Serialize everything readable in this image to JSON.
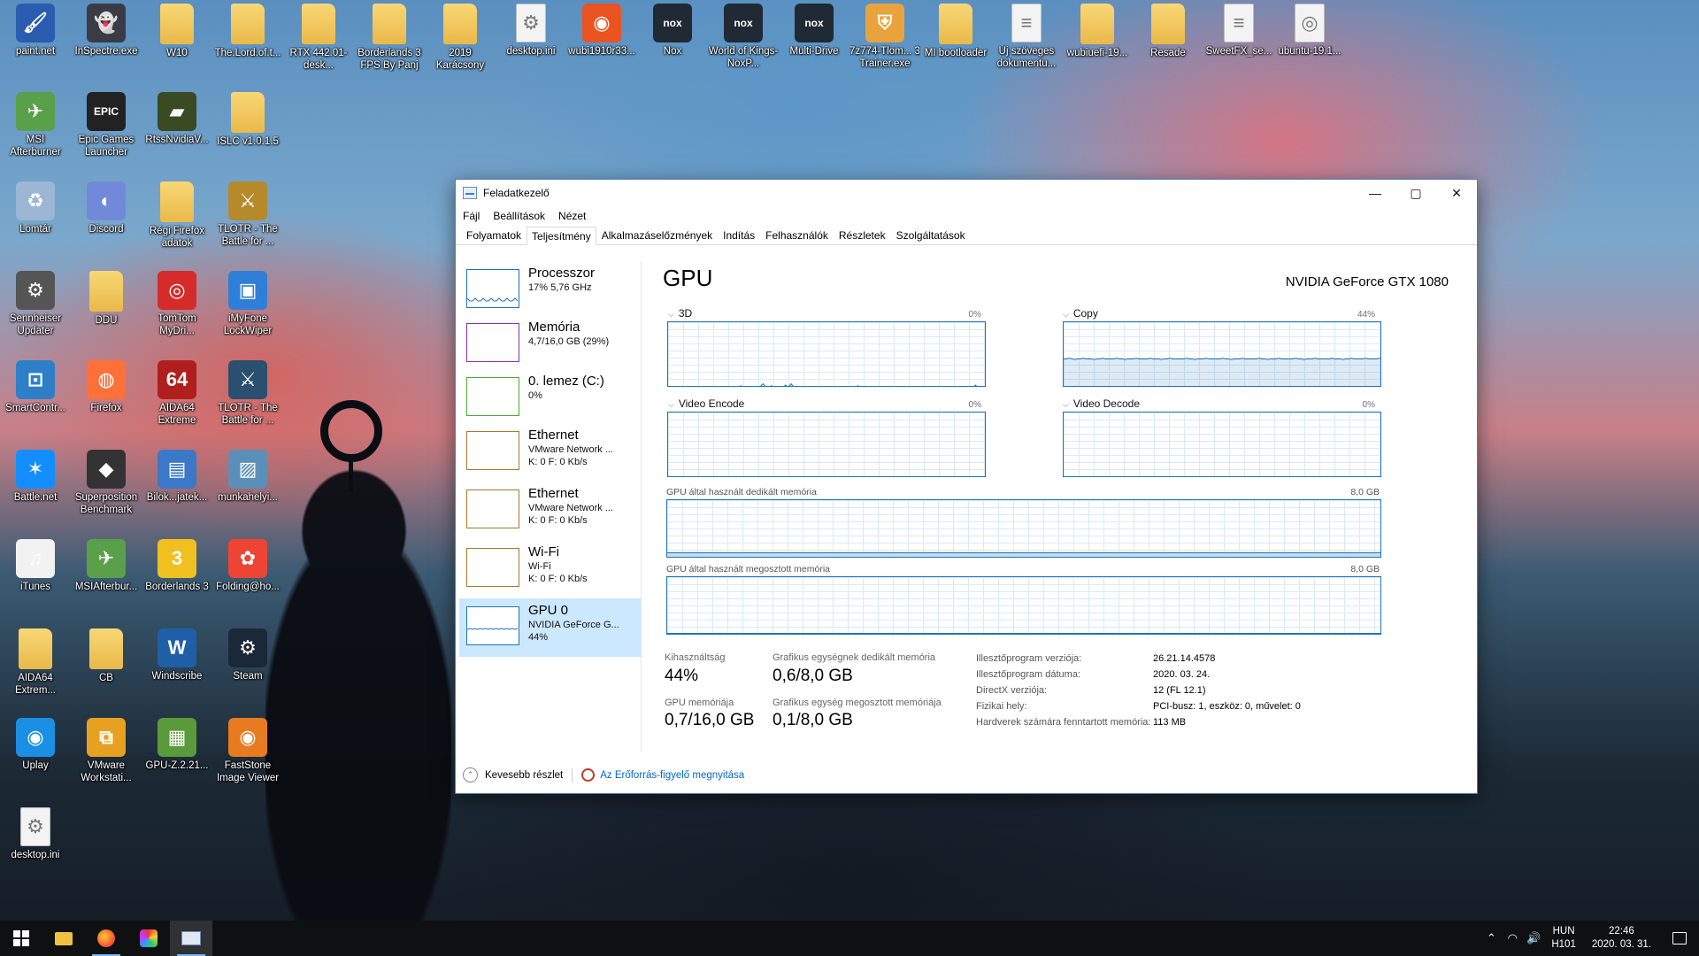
{
  "desktop_icons": [
    {
      "label": "paint.net",
      "icon": "paintnet-icon",
      "color": "#2a5db0",
      "glyph": "🖌"
    },
    {
      "label": "InSpectre.exe",
      "icon": "ghost-icon",
      "color": "#3b3b45",
      "glyph": "👻"
    },
    {
      "label": "W10",
      "icon": "folder-icon"
    },
    {
      "label": "The.Lord.of.t...",
      "icon": "folder-icon"
    },
    {
      "label": "RTX 442.01-desk...",
      "icon": "folder-icon"
    },
    {
      "label": "Borderlands 3 FPS By Panj",
      "icon": "folder-icon"
    },
    {
      "label": "2019 Karácsony",
      "icon": "folder-icon"
    },
    {
      "label": "desktop.ini",
      "icon": "settings-file-icon"
    },
    {
      "label": "wubi1910r33...",
      "icon": "ubuntu-icon",
      "color": "#e95420",
      "glyph": "◉"
    },
    {
      "label": "Nox",
      "icon": "nox-icon",
      "color": "#202a34",
      "glyph": "nox"
    },
    {
      "label": "World of Kings-NoxP...",
      "icon": "nox-icon",
      "color": "#202a34",
      "glyph": "nox"
    },
    {
      "label": "Multi-Drive",
      "icon": "nox-icon",
      "color": "#202a34",
      "glyph": "nox"
    },
    {
      "label": "7z774-Tlom... 3 Trainer.exe",
      "icon": "shield-exe-icon",
      "color": "#e8a33c",
      "glyph": "⛨"
    },
    {
      "label": "MI bootloader",
      "icon": "folder-icon"
    },
    {
      "label": "Új szöveges dokumentu...",
      "icon": "text-file-icon"
    },
    {
      "label": "wubiuefi-19...",
      "icon": "folder-icon"
    },
    {
      "label": "Resade",
      "icon": "folder-icon"
    },
    {
      "label": "SweetFX_se...",
      "icon": "text-file-icon"
    },
    {
      "label": "ubuntu-19.1...",
      "icon": "disc-file-icon"
    },
    {
      "label": "MSI Afterburner",
      "icon": "msi-afterburner-icon",
      "color": "#5aa04a",
      "glyph": "✈"
    },
    {
      "label": "Epic Games Launcher",
      "icon": "epic-games-icon",
      "color": "#222",
      "glyph": "EPIC"
    },
    {
      "label": "RtssNvidiaV...",
      "icon": "nvidia-icon",
      "color": "#3a4a22",
      "glyph": "▰"
    },
    {
      "label": "ISLC v1.0.1.5",
      "icon": "folder-icon"
    },
    {
      "label": "Lomtár",
      "icon": "recycle-bin-icon",
      "color": "#9bb7d4",
      "glyph": "♻"
    },
    {
      "label": "Discord",
      "icon": "discord-icon",
      "color": "#7289da",
      "glyph": "◐"
    },
    {
      "label": "Régi Firefox adatok",
      "icon": "folder-icon"
    },
    {
      "label": "TLOTR - The Battle for ...",
      "icon": "game-icon",
      "color": "#b48a2a",
      "glyph": "⚔"
    },
    {
      "label": "Sennheiser Updater",
      "icon": "gear-icon",
      "color": "#555",
      "glyph": "⚙"
    },
    {
      "label": "DDU",
      "icon": "folder-icon"
    },
    {
      "label": "TomTom MyDri...",
      "icon": "tomtom-icon",
      "color": "#d62b2b",
      "glyph": "◎"
    },
    {
      "label": "iMyFone LockWiper",
      "icon": "imyfone-icon",
      "color": "#2f7fd8",
      "glyph": "▣"
    },
    {
      "label": "SmartContr...",
      "icon": "smartcontrol-icon",
      "color": "#2d7fc8",
      "glyph": "⊡"
    },
    {
      "label": "Firefox",
      "icon": "firefox-icon",
      "color": "#ff7139",
      "glyph": "◍"
    },
    {
      "label": "AIDA64 Extreme",
      "icon": "aida64-icon",
      "color": "#b01e1e",
      "glyph": "64"
    },
    {
      "label": "TLOTR - The Battle for ...",
      "icon": "game-icon",
      "color": "#2b4f6e",
      "glyph": "⚔"
    },
    {
      "label": "Battle.net",
      "icon": "battlenet-icon",
      "color": "#148eff",
      "glyph": "✶"
    },
    {
      "label": "Superposition Benchmark",
      "icon": "superposition-icon",
      "color": "#333",
      "glyph": "◆"
    },
    {
      "label": "Bilok...jatek...",
      "icon": "document-icon",
      "color": "#3c78c8",
      "glyph": "▤"
    },
    {
      "label": "munkahelyi...",
      "icon": "image-icon",
      "color": "#5b8fb8",
      "glyph": "▨"
    },
    {
      "label": "iTunes",
      "icon": "itunes-icon",
      "color": "#f2f2f2",
      "glyph": "♫"
    },
    {
      "label": "MSIAfterbur...",
      "icon": "msi-afterburner-icon",
      "color": "#5aa04a",
      "glyph": "✈"
    },
    {
      "label": "Borderlands 3",
      "icon": "borderlands-icon",
      "color": "#f0c020",
      "glyph": "3"
    },
    {
      "label": "Folding@ho...",
      "icon": "folding-icon",
      "color": "#e43",
      "glyph": "✿"
    },
    {
      "label": "AIDA64 Extrem...",
      "icon": "folder-icon"
    },
    {
      "label": "CB",
      "icon": "folder-icon"
    },
    {
      "label": "Windscribe",
      "icon": "windscribe-icon",
      "color": "#1f5fa8",
      "glyph": "W"
    },
    {
      "label": "Steam",
      "icon": "steam-icon",
      "color": "#1b2838",
      "glyph": "⚙"
    },
    {
      "label": "Uplay",
      "icon": "uplay-icon",
      "color": "#1a8fe3",
      "glyph": "◉"
    },
    {
      "label": "VMware Workstati...",
      "icon": "vmware-icon",
      "color": "#e8a020",
      "glyph": "⧉"
    },
    {
      "label": "GPU-Z.2.21...",
      "icon": "gpuz-icon",
      "color": "#5b9a3a",
      "glyph": "▦"
    },
    {
      "label": "FastStone Image Viewer",
      "icon": "faststone-icon",
      "color": "#e87a20",
      "glyph": "◉"
    },
    {
      "label": "desktop.ini",
      "icon": "settings-file-icon"
    }
  ],
  "window": {
    "title": "Feladatkezelő",
    "menu": [
      "Fájl",
      "Beállítások",
      "Nézet"
    ],
    "tabs": [
      "Folyamatok",
      "Teljesítmény",
      "Alkalmazáselőzmények",
      "Indítás",
      "Felhasználók",
      "Részletek",
      "Szolgáltatások"
    ],
    "active_tab": "Teljesítmény"
  },
  "left_panel": [
    {
      "name": "Processzor",
      "sub1": "17%  5,76 GHz",
      "sub2": "",
      "color": "#1f74b5"
    },
    {
      "name": "Memória",
      "sub1": "4,7/16,0 GB (29%)",
      "sub2": "",
      "color": "#8b2fb0"
    },
    {
      "name": "0. lemez (C:)",
      "sub1": "0%",
      "sub2": "",
      "color": "#4ea72e"
    },
    {
      "name": "Ethernet",
      "sub1": "VMware Network ...",
      "sub2": "K: 0  F: 0 Kb/s",
      "color": "#a5792a"
    },
    {
      "name": "Ethernet",
      "sub1": "VMware Network ...",
      "sub2": "K: 0  F: 0 Kb/s",
      "color": "#a5792a"
    },
    {
      "name": "Wi-Fi",
      "sub1": "Wi-Fi",
      "sub2": "K: 0  F: 0 Kb/s",
      "color": "#a5792a"
    },
    {
      "name": "GPU 0",
      "sub1": "NVIDIA GeForce G...",
      "sub2": "44%",
      "color": "#1f74b5"
    }
  ],
  "gpu": {
    "title": "GPU",
    "model": "NVIDIA GeForce GTX 1080",
    "engines": [
      {
        "name": "3D",
        "pct": "0%",
        "usage": [
          0,
          0,
          0,
          0,
          0,
          1,
          0,
          0,
          0,
          0,
          0,
          0,
          0,
          0,
          0,
          0,
          0,
          0,
          0,
          0,
          0,
          0,
          0,
          0,
          0,
          0,
          3,
          1,
          0,
          0,
          0,
          0,
          0,
          2,
          6,
          1,
          0,
          3,
          0,
          0,
          0,
          0,
          4,
          1,
          6,
          1,
          0,
          0,
          0,
          0,
          0,
          0,
          0,
          0,
          0,
          0,
          0,
          0,
          0,
          0,
          0,
          0,
          0,
          2,
          0,
          0,
          0,
          0,
          3,
          0,
          0,
          0,
          0,
          0,
          0,
          0,
          0,
          0,
          0,
          0,
          0,
          2,
          0,
          0,
          0,
          0,
          0,
          0,
          0,
          0,
          0,
          0,
          0,
          0,
          0,
          0,
          0,
          0,
          0,
          0,
          0,
          0,
          0,
          0,
          0,
          0,
          0,
          0,
          0,
          0,
          4,
          0,
          0,
          0,
          0
        ]
      },
      {
        "name": "Copy",
        "pct": "44%",
        "usage": [
          44,
          44,
          45,
          44,
          43,
          44,
          44,
          45,
          44,
          44,
          44,
          43,
          44,
          44,
          45,
          44,
          44,
          44,
          44,
          45,
          44,
          44,
          43,
          44,
          44,
          44,
          45,
          44,
          44,
          44,
          44,
          45,
          44,
          44,
          44,
          43,
          44,
          44,
          45,
          44,
          44,
          44,
          44,
          44,
          45,
          44,
          44,
          43,
          44,
          44,
          44,
          45,
          44,
          44,
          44,
          44,
          44,
          45,
          44,
          44,
          43,
          44,
          44,
          44,
          45,
          44,
          44,
          44,
          44,
          44,
          45,
          44,
          44,
          43,
          44,
          44,
          44,
          45,
          44,
          44,
          44,
          44,
          44,
          45,
          44,
          44,
          43,
          44,
          44,
          44,
          45,
          44,
          44,
          44,
          44,
          44,
          45,
          44,
          44,
          44,
          43,
          44,
          44,
          45,
          44,
          44,
          44,
          44,
          45,
          44,
          44,
          44,
          44,
          45,
          44
        ]
      },
      {
        "name": "Video Encode",
        "pct": "0%",
        "usage": []
      },
      {
        "name": "Video Decode",
        "pct": "0%",
        "usage": []
      }
    ],
    "dedicated_label": "GPU által használt dedikált memória",
    "dedicated_max": "8,0 GB",
    "shared_label": "GPU által használt megosztott memória",
    "shared_max": "8,0 GB",
    "stats": {
      "util_label": "Kihasználtság",
      "util_value": "44%",
      "ded_label": "Grafikus egységnek dedikált memória",
      "ded_value": "0,6/8,0 GB",
      "gpumem_label": "GPU memóriája",
      "gpumem_value": "0,7/16,0 GB",
      "shared_label": "Grafikus egység megosztott memóriája",
      "shared_value": "0,1/8,0 GB"
    },
    "info": [
      {
        "k": "Illesztőprogram verziója:",
        "v": "26.21.14.4578"
      },
      {
        "k": "Illesztőprogram dátuma:",
        "v": "2020. 03. 24."
      },
      {
        "k": "DirectX verziója:",
        "v": "12 (FL 12.1)"
      },
      {
        "k": "Fizikai hely:",
        "v": "PCI-busz: 1, eszköz: 0, művelet: 0"
      },
      {
        "k": "Hardverek számára fenntartott memória:",
        "v": "113 MB"
      }
    ]
  },
  "footer": {
    "less_details": "Kevesebb részlet",
    "resource_monitor": "Az Erőforrás-figyelő megnyitása"
  },
  "taskbar": {
    "lang1": "HUN",
    "lang2": "H101",
    "time": "22:46",
    "date": "2020. 03. 31."
  }
}
